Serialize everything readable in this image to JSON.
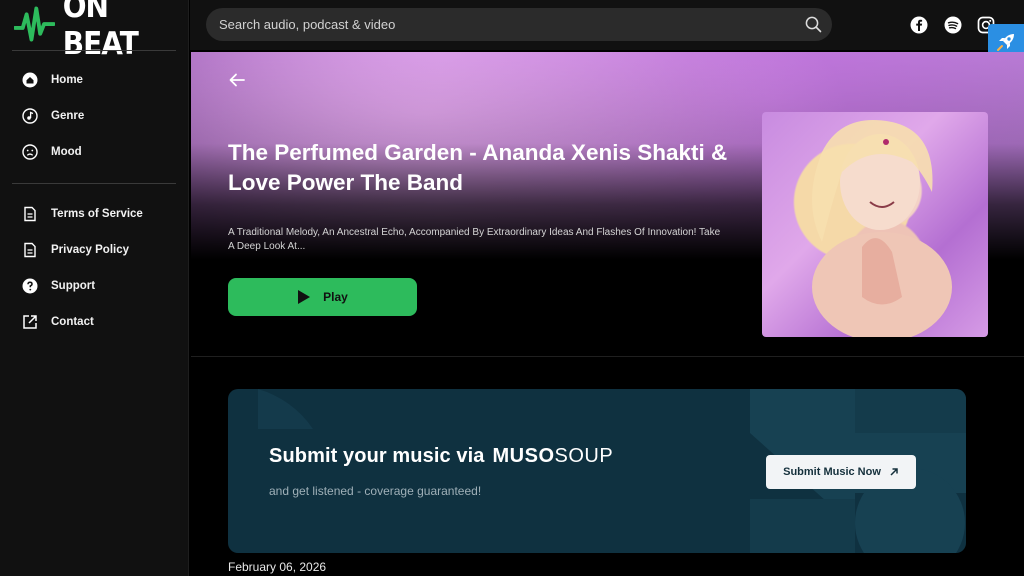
{
  "brand": {
    "name": "ON BEAT",
    "accent": "#2dbb5c"
  },
  "search": {
    "placeholder": "Search audio, podcast & video"
  },
  "social": [
    "facebook-icon",
    "spotify-icon",
    "instagram-icon"
  ],
  "sidebar": {
    "primary": [
      {
        "label": "Home",
        "icon": "home-icon"
      },
      {
        "label": "Genre",
        "icon": "music-note-icon"
      },
      {
        "label": "Mood",
        "icon": "face-icon"
      }
    ],
    "secondary": [
      {
        "label": "Terms of Service",
        "icon": "document-icon"
      },
      {
        "label": "Privacy Policy",
        "icon": "document-icon"
      },
      {
        "label": "Support",
        "icon": "help-icon"
      },
      {
        "label": "Contact",
        "icon": "external-link-icon"
      }
    ]
  },
  "hero": {
    "title": "The Perfumed Garden - Ananda Xenis Shakti & Love Power The Band",
    "description": "A Traditional Melody, An Ancestral Echo, Accompanied By Extraordinary Ideas And Flashes Of Innovation! Take A Deep Look At...",
    "play_label": "Play"
  },
  "promo": {
    "title": "Submit your music via",
    "brand_bold": "MUSO",
    "brand_light": "SOUP",
    "subtitle": "and get listened - coverage guaranteed!",
    "button_label": "Submit Music Now"
  },
  "post": {
    "date": "February 06, 2026"
  }
}
